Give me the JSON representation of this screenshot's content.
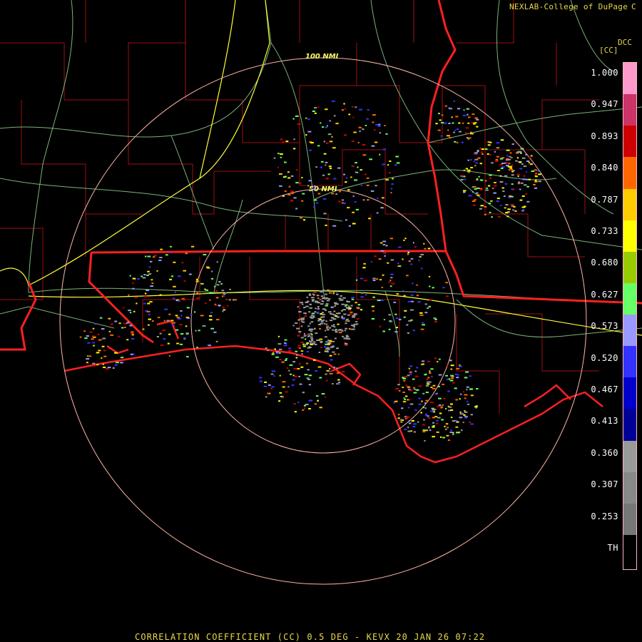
{
  "header": {
    "credit": "NEXLAB-College of DuPage",
    "credit_mark": "C",
    "product_code": "DCC",
    "unit": "[CC]"
  },
  "map": {
    "range_rings": [
      "50 NMI",
      "100 NMI"
    ],
    "colors": {
      "background": "#000000",
      "state_border": "#ff2020",
      "county_border": "#a01010",
      "highway": "#ffff33",
      "roads": "#8fd48f",
      "range_ring": "#ffb6a8"
    }
  },
  "legend": {
    "ticks": [
      "1.000",
      "0.947",
      "0.893",
      "0.840",
      "0.787",
      "0.733",
      "0.680",
      "0.627",
      "0.573",
      "0.520",
      "0.467",
      "0.413",
      "0.360",
      "0.307",
      "0.253",
      "TH"
    ],
    "colors": [
      "#ff99cc",
      "#cc3366",
      "#cc0000",
      "#ff6600",
      "#ffcc00",
      "#ffff00",
      "#99cc00",
      "#66ff66",
      "#9999ff",
      "#3333ff",
      "#0000cc",
      "#000099",
      "#999999",
      "#888888",
      "#777777",
      "#000000"
    ]
  },
  "footer": {
    "title": "CORRELATION COEFFICIENT (CC) 0.5 DEG - KEVX 20 JAN 26 07:22"
  }
}
